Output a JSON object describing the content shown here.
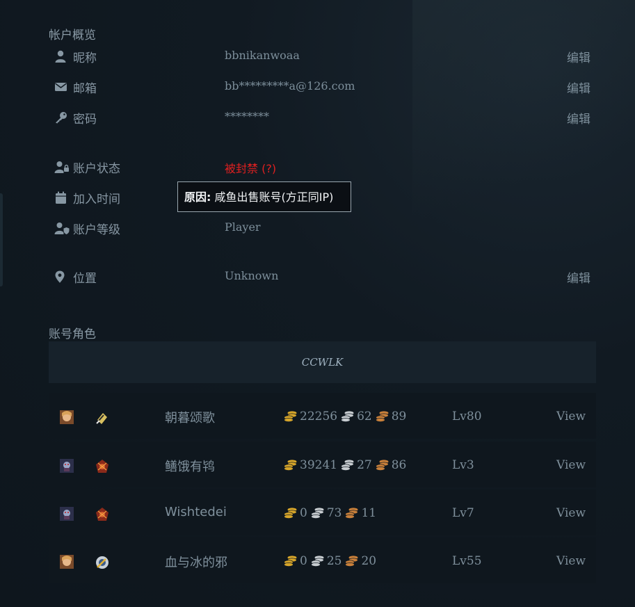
{
  "overview": {
    "title": "帐户概览",
    "nickname": {
      "label": "昵称",
      "value": "bbnikanwoaa",
      "edit": "编辑"
    },
    "email": {
      "label": "邮箱",
      "value": "bb*********a@126.com",
      "edit": "编辑"
    },
    "password": {
      "label": "密码",
      "value": "********",
      "edit": "编辑"
    },
    "status": {
      "label": "账户状态",
      "value": "被封禁 (?)"
    },
    "joined": {
      "label": "加入时间"
    },
    "tier": {
      "label": "账户等级",
      "value": "Player"
    },
    "location": {
      "label": "位置",
      "value": "Unknown",
      "edit": "编辑"
    }
  },
  "tooltip": {
    "bold": "原因:",
    "text": " 咸鱼出售账号(方正同IP)"
  },
  "characters": {
    "title": "账号角色",
    "realm": "CCWLK",
    "rows": [
      {
        "race_icon": "human-female-icon",
        "class_icon": "hunter-icon",
        "name": "朝暮颂歌",
        "gold": "22256",
        "silver": "62",
        "copper": "89",
        "level": "Lv80",
        "view": "View"
      },
      {
        "race_icon": "undead-icon",
        "class_icon": "warlock-icon",
        "name": "鳝饿有鸨",
        "gold": "39241",
        "silver": "27",
        "copper": "86",
        "level": "Lv3",
        "view": "View"
      },
      {
        "race_icon": "undead-icon",
        "class_icon": "warlock-icon",
        "name": "Wishtedei",
        "gold": "0",
        "silver": "73",
        "copper": "11",
        "level": "Lv7",
        "view": "View"
      },
      {
        "race_icon": "human-female-icon",
        "class_icon": "priest-icon",
        "name": "血与冰的邪",
        "gold": "0",
        "silver": "25",
        "copper": "20",
        "level": "Lv55",
        "view": "View"
      }
    ]
  },
  "colors": {
    "banned": "#e02020",
    "gold": "#d6a52a",
    "silver": "#c7ccd0",
    "copper": "#c9803a"
  }
}
